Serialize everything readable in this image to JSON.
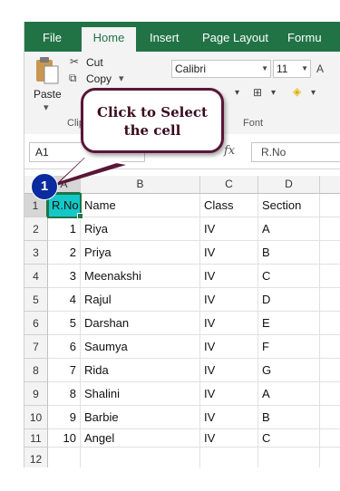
{
  "ribbon_tabs": [
    "File",
    "Home",
    "Insert",
    "Page Layout",
    "Formu"
  ],
  "active_tab": "Home",
  "ribbon": {
    "paste_label": "Paste",
    "cut_label": "Cut",
    "copy_label": "Copy",
    "clipboard_group_label": "Clip",
    "font_group_label": "Font",
    "font_name": "Calibri",
    "font_size": "11"
  },
  "formula_bar": {
    "name_box": "A1",
    "fx_label": "fx",
    "content": "R.No"
  },
  "callout": {
    "line1": "Click to Select",
    "line2": "the cell"
  },
  "step_number": "1",
  "columns": [
    "A",
    "B",
    "C",
    "D"
  ],
  "rows": [
    {
      "num": "1",
      "a": "R.No",
      "b": "Name",
      "c": "Class",
      "d": "Section"
    },
    {
      "num": "2",
      "a": "1",
      "b": "Riya",
      "c": "IV",
      "d": "A"
    },
    {
      "num": "3",
      "a": "2",
      "b": "Priya",
      "c": "IV",
      "d": "B"
    },
    {
      "num": "4",
      "a": "3",
      "b": "Meenakshi",
      "c": "IV",
      "d": "C"
    },
    {
      "num": "5",
      "a": "4",
      "b": "Rajul",
      "c": "IV",
      "d": "D"
    },
    {
      "num": "6",
      "a": "5",
      "b": "Darshan",
      "c": "IV",
      "d": "E"
    },
    {
      "num": "7",
      "a": "6",
      "b": "Saumya",
      "c": "IV",
      "d": "F"
    },
    {
      "num": "8",
      "a": "7",
      "b": "Rida",
      "c": "IV",
      "d": "G"
    },
    {
      "num": "9",
      "a": "8",
      "b": "Shalini",
      "c": "IV",
      "d": "A"
    },
    {
      "num": "10",
      "a": "9",
      "b": "Barbie",
      "c": "IV",
      "d": "B"
    },
    {
      "num": "11",
      "a": "10",
      "b": "Angel",
      "c": "IV",
      "d": "C"
    },
    {
      "num": "12",
      "a": "",
      "b": "",
      "c": "",
      "d": ""
    }
  ],
  "colors": {
    "excel_green": "#217346",
    "selected_cell_fill": "#14c8c8",
    "callout_border": "#5a1637",
    "step_badge": "#0b2b9e"
  }
}
